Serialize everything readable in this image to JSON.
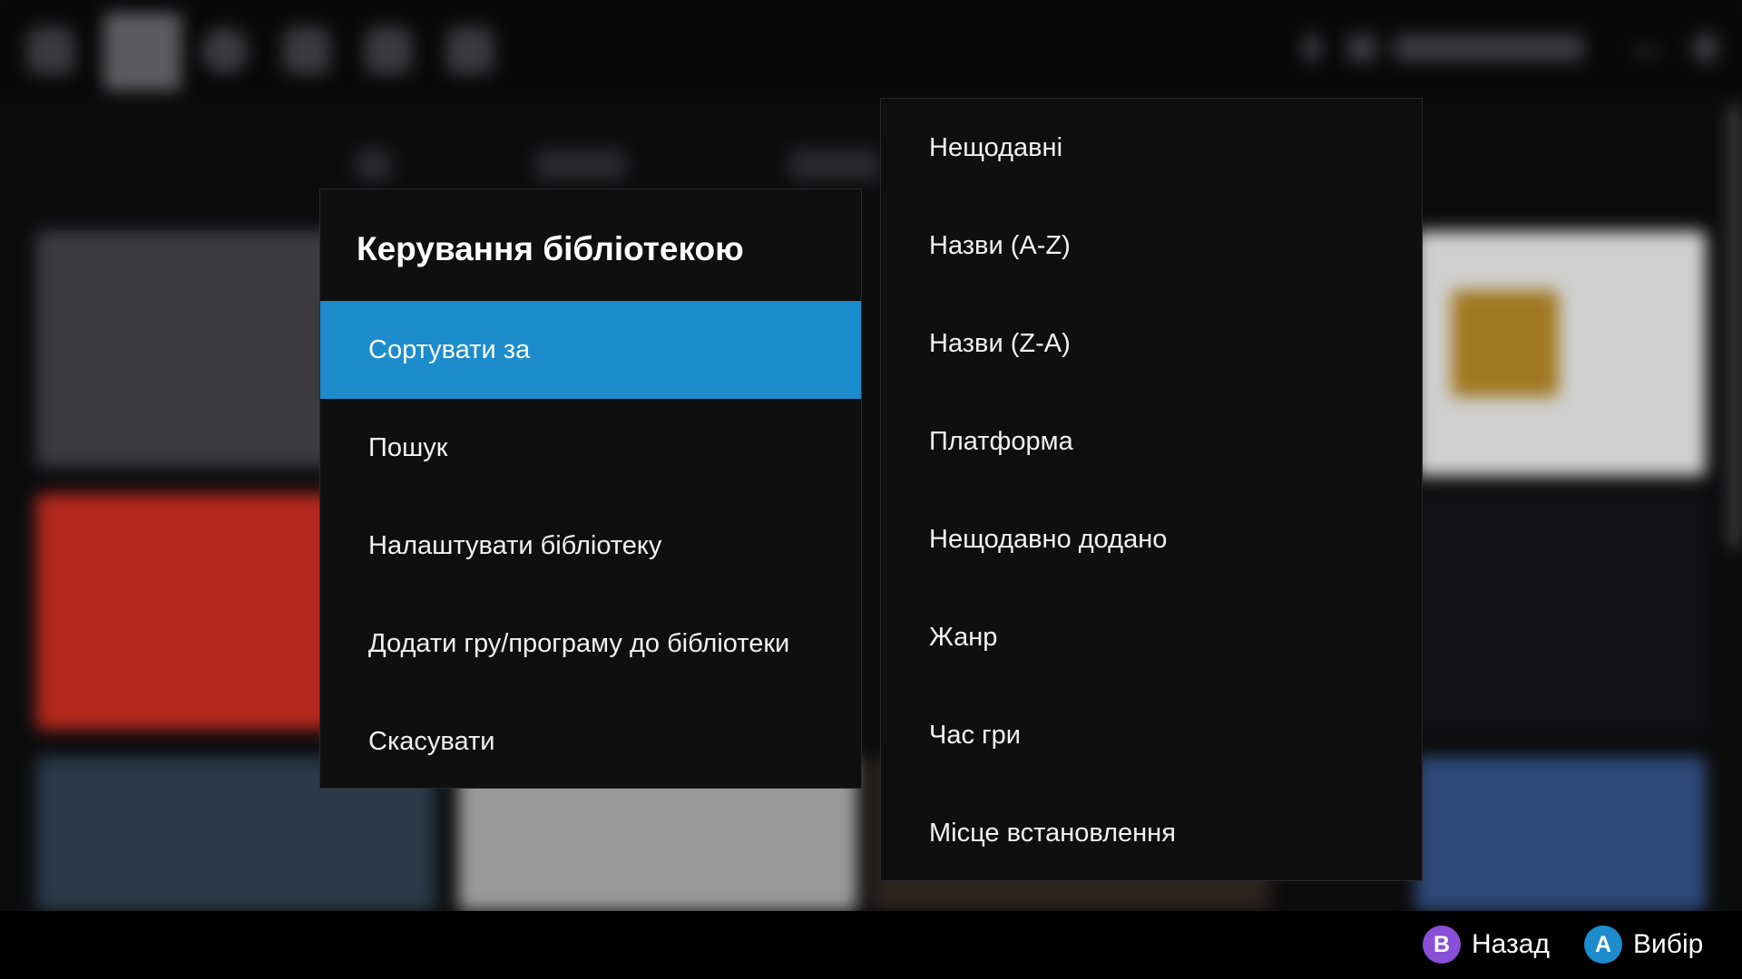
{
  "library_menu": {
    "title": "Керування бібліотекою",
    "items": [
      {
        "label": "Сортувати за",
        "selected": true
      },
      {
        "label": "Пошук"
      },
      {
        "label": "Налаштувати бібліотеку"
      },
      {
        "label": "Додати гру/програму до бібліотеки"
      },
      {
        "label": "Скасувати"
      }
    ]
  },
  "sort_menu": {
    "items": [
      {
        "label": "Нещодавні"
      },
      {
        "label": "Назви (A-Z)"
      },
      {
        "label": "Назви (Z-A)"
      },
      {
        "label": "Платформа"
      },
      {
        "label": "Нещодавно додано"
      },
      {
        "label": "Жанр"
      },
      {
        "label": "Час гри"
      },
      {
        "label": "Місце встановлення"
      }
    ]
  },
  "hints": {
    "back": {
      "button": "B",
      "label": "Назад",
      "color": "#8a4fd6"
    },
    "select": {
      "button": "A",
      "label": "Вибір",
      "color": "#1c8ccd"
    }
  },
  "colors": {
    "accent": "#1c8ccd",
    "panel": "#0f0f10"
  }
}
